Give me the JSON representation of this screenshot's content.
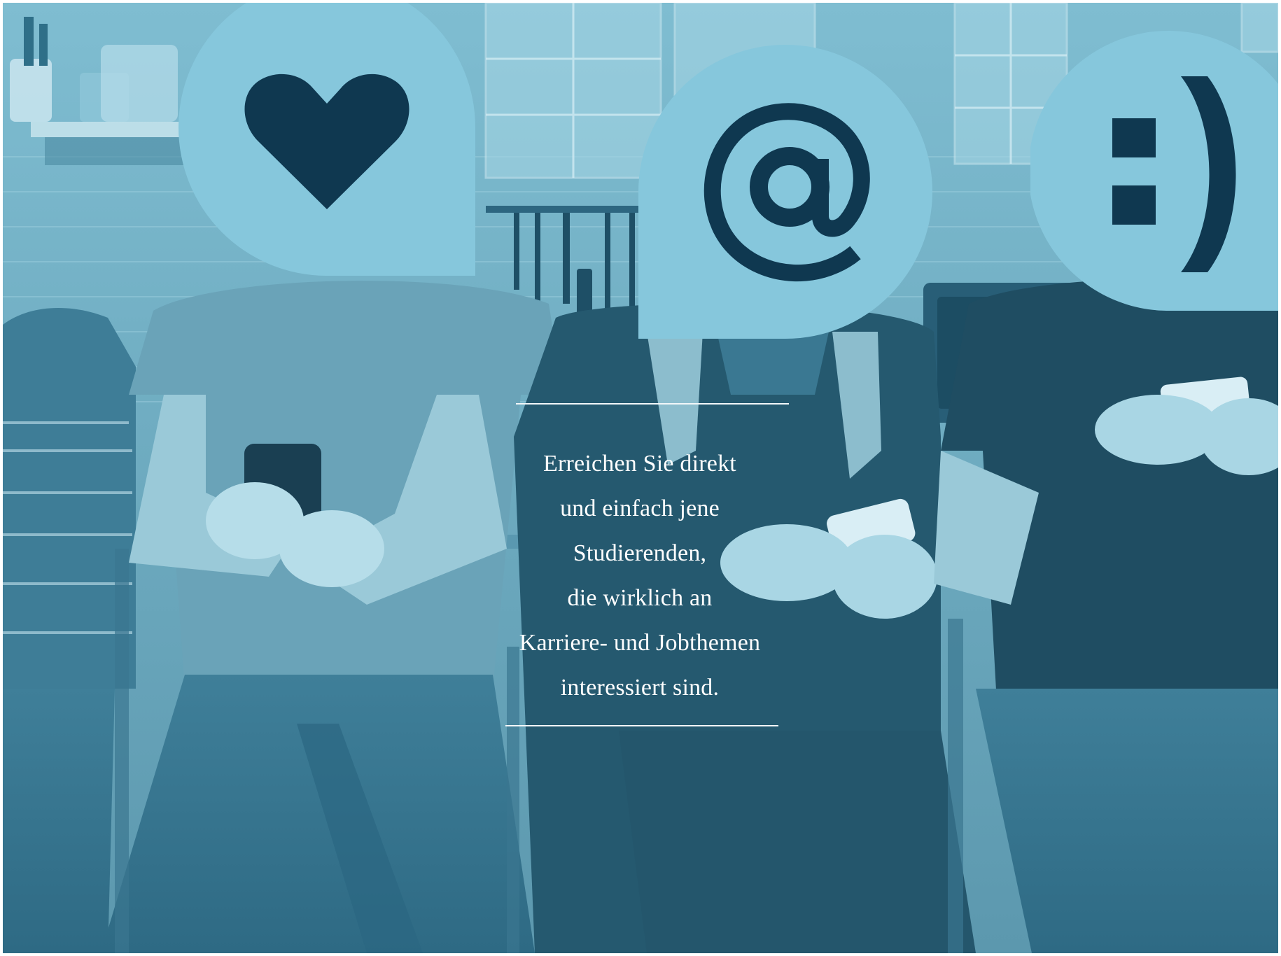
{
  "caption": {
    "line_1": "Erreichen Sie direkt",
    "line_2": "und einfach jene",
    "line_3": "Studierenden,",
    "line_4": "die wirklich an",
    "line_5": "Karriere- und Jobthemen",
    "line_6": "interessiert sind."
  },
  "speech_bubbles": [
    {
      "icon": "heart-icon",
      "symbol": "♥"
    },
    {
      "icon": "at-sign-icon",
      "symbol": "@"
    },
    {
      "icon": "smiley-icon",
      "symbol": ":)"
    }
  ],
  "colors": {
    "photo_tint": "#5f9fb5",
    "bubble_fill": "#86c7dc",
    "icon_color": "#0f3850",
    "caption_text": "#ffffff",
    "divider": "#f2f7f9"
  }
}
